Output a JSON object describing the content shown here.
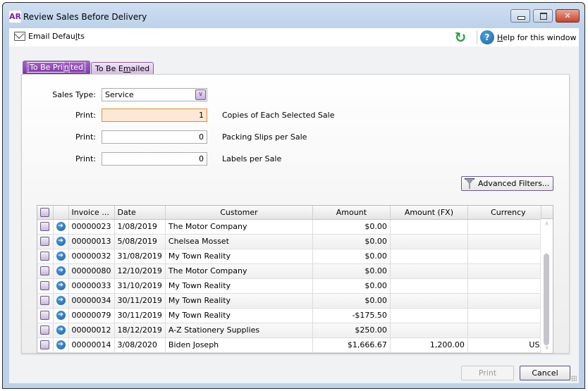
{
  "window": {
    "app_badge": "AR",
    "title": "Review Sales Before Delivery",
    "controls": {
      "minimize": "minimize",
      "maximize": "maximize",
      "close": "✕"
    }
  },
  "toolbar": {
    "email_defaults": {
      "pre": "Email Defau",
      "ul": "l",
      "post": "ts"
    },
    "refresh_icon": "refresh-icon",
    "help": {
      "ul": "H",
      "post": "elp for this window"
    }
  },
  "tabs": [
    {
      "pre": "To Be Pri",
      "ul": "n",
      "post": "ted",
      "active": true
    },
    {
      "pre": "To Be E",
      "ul": "m",
      "post": "ailed",
      "active": false
    }
  ],
  "form": {
    "sales_type_label": "Sales Type:",
    "sales_type_value": "Service",
    "print_label": "Print:",
    "copies_value": "1",
    "copies_desc": "Copies of Each Selected Sale",
    "packing_value": "0",
    "packing_desc": "Packing Slips per Sale",
    "labels_value": "0",
    "labels_desc": "Labels per Sale",
    "advanced_filters": "Advanced Filters..."
  },
  "grid": {
    "columns": [
      "",
      "",
      "Invoice ...",
      "Date",
      "Customer",
      "Amount",
      "Amount (FX)",
      "Currency"
    ],
    "rows": [
      {
        "invoice": "00000023",
        "date": "1/08/2019",
        "customer": "The Motor Company",
        "amount": "$0.00",
        "amount_fx": "",
        "currency": ""
      },
      {
        "invoice": "00000013",
        "date": "5/08/2019",
        "customer": "Chelsea Mosset",
        "amount": "$0.00",
        "amount_fx": "",
        "currency": ""
      },
      {
        "invoice": "00000032",
        "date": "31/08/2019",
        "customer": "My Town Reality",
        "amount": "$0.00",
        "amount_fx": "",
        "currency": ""
      },
      {
        "invoice": "00000080",
        "date": "12/10/2019",
        "customer": "The Motor Company",
        "amount": "$0.00",
        "amount_fx": "",
        "currency": ""
      },
      {
        "invoice": "00000033",
        "date": "31/10/2019",
        "customer": "My Town Reality",
        "amount": "$0.00",
        "amount_fx": "",
        "currency": ""
      },
      {
        "invoice": "00000034",
        "date": "30/11/2019",
        "customer": "My Town Reality",
        "amount": "$0.00",
        "amount_fx": "",
        "currency": ""
      },
      {
        "invoice": "00000079",
        "date": "30/11/2019",
        "customer": "My Town Reality",
        "amount": "-$175.50",
        "amount_fx": "",
        "currency": ""
      },
      {
        "invoice": "00000012",
        "date": "18/12/2019",
        "customer": "A-Z Stationery Supplies",
        "amount": "$250.00",
        "amount_fx": "",
        "currency": ""
      },
      {
        "invoice": "00000014",
        "date": "3/08/2020",
        "customer": "Biden Joseph",
        "amount": "$1,666.67",
        "amount_fx": "1,200.00",
        "currency": "USD"
      }
    ]
  },
  "footer": {
    "print": "Print",
    "cancel": "Cancel",
    "print_enabled": false
  },
  "colors": {
    "accent_purple": "#7c35a6",
    "focus_orange": "#e09035",
    "focus_fill": "#fde8d5"
  }
}
